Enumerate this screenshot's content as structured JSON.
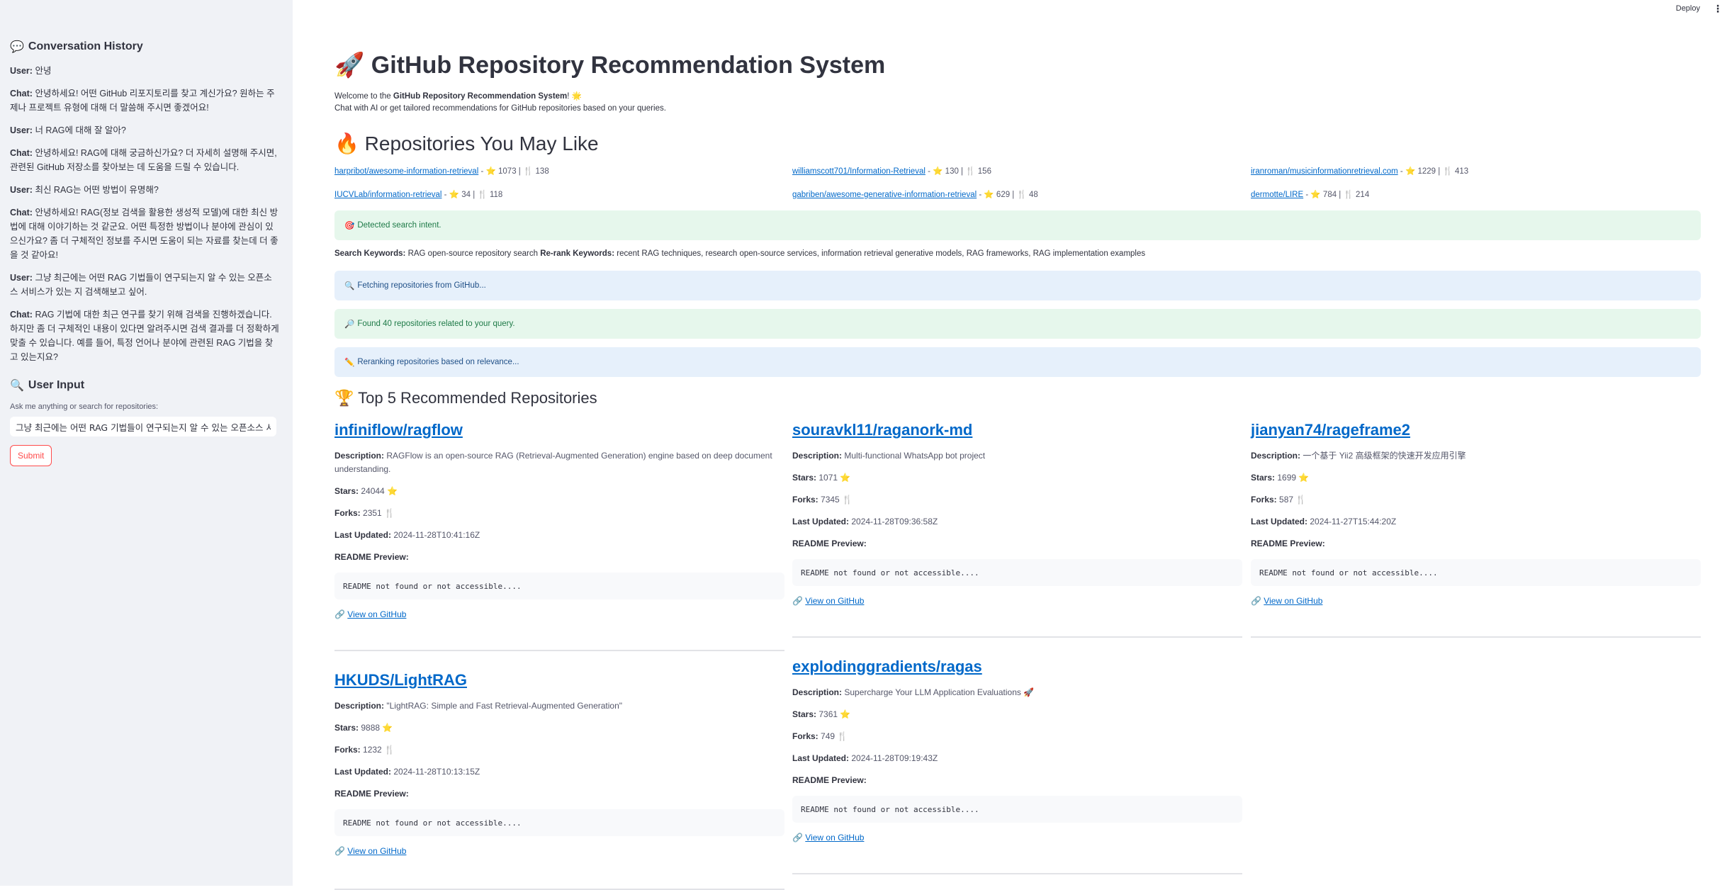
{
  "topbar": {
    "deploy": "Deploy",
    "menu_icon": "⋮"
  },
  "sidebar": {
    "history_title": "Conversation History",
    "messages": [
      {
        "role": "User:",
        "text": "안녕"
      },
      {
        "role": "Chat:",
        "text": "안녕하세요! 어떤 GitHub 리포지토리를 찾고 계신가요? 원하는 주제나 프로젝트 유형에 대해 더 말씀해 주시면 좋겠어요!"
      },
      {
        "role": "User:",
        "text": "너 RAG에 대해 잘 알아?"
      },
      {
        "role": "Chat:",
        "text": "안녕하세요! RAG에 대해 궁금하신가요? 더 자세히 설명해 주시면, 관련된 GitHub 저장소를 찾아보는 데 도움을 드릴 수 있습니다."
      },
      {
        "role": "User:",
        "text": "최신 RAG는 어떤 방법이 유명해?"
      },
      {
        "role": "Chat:",
        "text": "안녕하세요! RAG(정보 검색을 활용한 생성적 모델)에 대한 최신 방법에 대해 이야기하는 것 같군요. 어떤 특정한 방법이나 분야에 관심이 있으신가요? 좀 더 구체적인 정보를 주시면 도움이 되는 자료를 찾는데 더 좋을 것 같아요!"
      },
      {
        "role": "User:",
        "text": "그냥 최근에는 어떤 RAG 기법들이 연구되는지 알 수 있는 오픈소스 서비스가 있는 지 검색해보고 싶어."
      },
      {
        "role": "Chat:",
        "text": "RAG 기법에 대한 최근 연구를 찾기 위해 검색을 진행하겠습니다. 하지만 좀 더 구체적인 내용이 있다면 알려주시면 검색 결과를 더 정확하게 맞출 수 있습니다. 예를 들어, 특정 언어나 분야에 관련된 RAG 기법을 찾고 있는지요?"
      }
    ],
    "input_title": "User Input",
    "input_label": "Ask me anything or search for repositories:",
    "input_value": "그냥 최근에는 어떤 RAG 기법들이 연구되는지 알 수 있는 오픈소스 서비스가 있는 지 검색해보고 싶어.",
    "submit": "Submit"
  },
  "main": {
    "title": "GitHub Repository Recommendation System",
    "welcome_prefix": "Welcome to the ",
    "welcome_bold": "GitHub Repository Recommendation System",
    "welcome_suffix": "! 🌟",
    "subtitle": "Chat with AI or get tailored recommendations for GitHub repositories based on your queries.",
    "may_like_title": "Repositories You May Like",
    "may_like": [
      {
        "name": "harpribot/awesome-information-retrieval",
        "stars": "1073",
        "forks": "138"
      },
      {
        "name": "williamscott701/Information-Retrieval",
        "stars": "130",
        "forks": "156"
      },
      {
        "name": "iranroman/musicinformationretrieval.com",
        "stars": "1229",
        "forks": "413"
      },
      {
        "name": "IUCVLab/information-retrieval",
        "stars": "34",
        "forks": "118"
      },
      {
        "name": "gabriben/awesome-generative-information-retrieval",
        "stars": "629",
        "forks": "48"
      },
      {
        "name": "dermotte/LIRE",
        "stars": "784",
        "forks": "214"
      }
    ],
    "detected": "Detected search intent.",
    "search_kw_label": "Search Keywords:",
    "search_kw": "RAG open-source repository search",
    "rerank_kw_label": "Re-rank Keywords:",
    "rerank_kw": "recent RAG techniques, research open-source services, information retrieval generative models, RAG frameworks, RAG implementation examples",
    "fetching": "Fetching repositories from GitHub...",
    "found": "Found 40 repositories related to your query.",
    "reranking": "Reranking repositories based on relevance...",
    "top_title": "Top 5 Recommended Repositories",
    "labels": {
      "description": "Description:",
      "stars": "Stars:",
      "forks": "Forks:",
      "updated": "Last Updated:",
      "readme": "README Preview:",
      "view": "View on GitHub"
    },
    "repos": [
      {
        "name": "infiniflow/ragflow",
        "description": "RAGFlow is an open-source RAG (Retrieval-Augmented Generation) engine based on deep document understanding.",
        "stars": "24044",
        "forks": "2351",
        "updated": "2024-11-28T10:41:16Z",
        "readme": "README not found or not accessible...."
      },
      {
        "name": "souravkl11/raganork-md",
        "description": "Multi-functional WhatsApp bot project",
        "stars": "1071",
        "forks": "7345",
        "updated": "2024-11-28T09:36:58Z",
        "readme": "README not found or not accessible...."
      },
      {
        "name": "jianyan74/rageframe2",
        "description": "一个基于 Yii2 高级框架的快速开发应用引擎",
        "stars": "1699",
        "forks": "587",
        "updated": "2024-11-27T15:44:20Z",
        "readme": "README not found or not accessible...."
      },
      {
        "name": "HKUDS/LightRAG",
        "description": "\"LightRAG: Simple and Fast Retrieval-Augmented Generation\"",
        "stars": "9888",
        "forks": "1232",
        "updated": "2024-11-28T10:13:15Z",
        "readme": "README not found or not accessible...."
      },
      {
        "name": "explodinggradients/ragas",
        "description": "Supercharge Your LLM Application Evaluations 🚀",
        "stars": "7361",
        "forks": "749",
        "updated": "2024-11-28T09:19:43Z",
        "readme": "README not found or not accessible...."
      }
    ]
  }
}
